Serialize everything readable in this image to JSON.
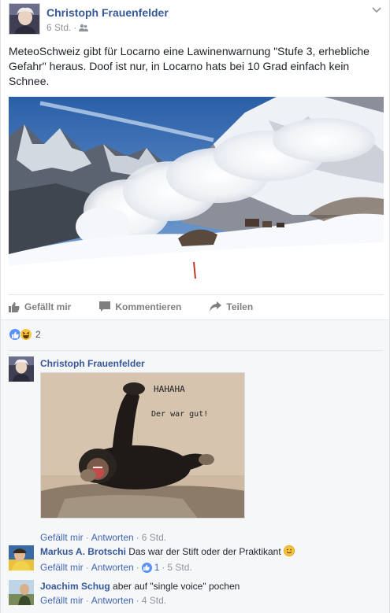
{
  "post": {
    "author": "Christoph Frauenfelder",
    "time": "6 Std.",
    "privacy_icon": "friends-icon",
    "text": "MeteoSchweiz gibt für Locarno eine Lawinenwarnung \"Stufe 3, erhebliche Gefahr\" heraus. Doof ist nur, in Locarno hats bei 10 Grad einfach kein Schnee."
  },
  "actions": {
    "like": "Gefällt mir",
    "comment": "Kommentieren",
    "share": "Teilen"
  },
  "reactions": {
    "count": "2",
    "types": [
      "like-icon",
      "haha-icon"
    ]
  },
  "comments": [
    {
      "author": "Christoph Frauenfelder",
      "text": "",
      "image_text": [
        "HAHAHA",
        "Der war gut!"
      ],
      "like_label": "Gefällt mir",
      "reply_label": "Antworten",
      "time": "6 Std."
    },
    {
      "author": "Markus A. Brotschi",
      "text": "Das war der Stift oder der Praktikant",
      "like_label": "Gefällt mir",
      "reply_label": "Antworten",
      "likes": "1",
      "time": "5 Std."
    },
    {
      "author": "Joachim Schug",
      "text": "aber auf \"single voice\" pochen",
      "like_label": "Gefällt mir",
      "reply_label": "Antworten",
      "time": "4 Std."
    }
  ],
  "colors": {
    "link": "#365899",
    "meta": "#90949c",
    "like_blue": "#5890ff",
    "comments_bg": "#f6f7f9"
  }
}
